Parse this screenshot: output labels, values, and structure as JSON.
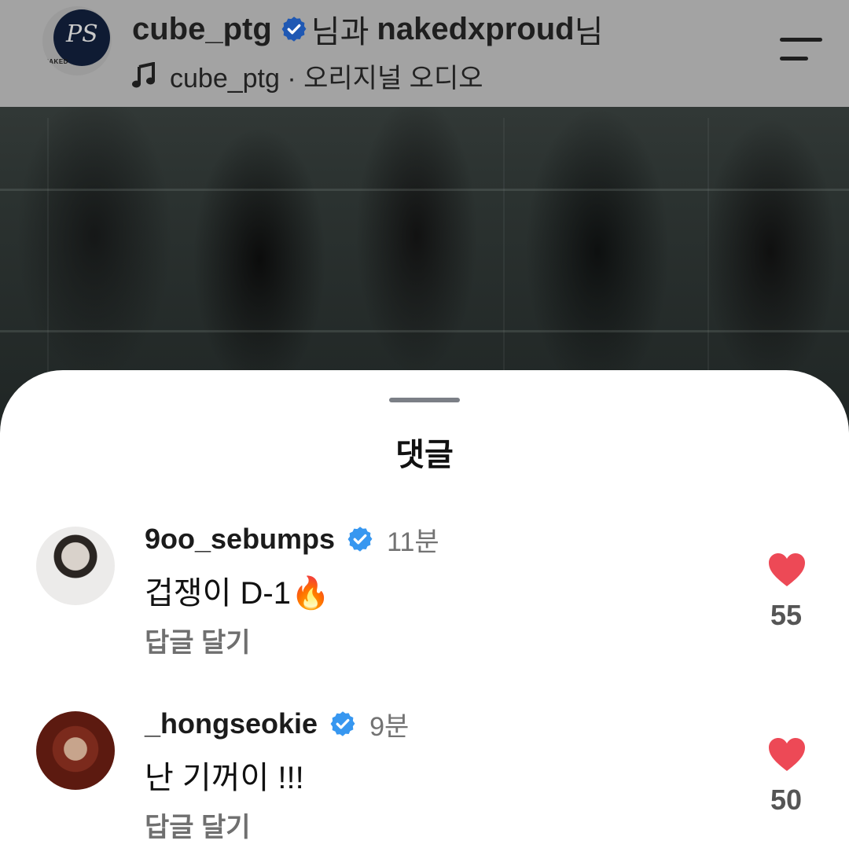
{
  "header": {
    "avatar_monogram": "PS",
    "avatar_brand": "NAKED",
    "username": "cube_ptg",
    "with_suffix": "님과",
    "collaborator": "nakedxproud",
    "collaborator_suffix": "님",
    "audio": "cube_ptg · 오리지널 오디오"
  },
  "sheet": {
    "title": "댓글"
  },
  "comments": [
    {
      "username": "9oo_sebumps",
      "time": "11분",
      "text": "겁쟁이 D-1🔥",
      "reply": "답글 달기",
      "likes": "55"
    },
    {
      "username": "_hongseokie",
      "time": "9분",
      "text": "난 기꺼이 !!!",
      "reply": "답글 달기",
      "likes": "50"
    }
  ],
  "colors": {
    "verified": "#3797f0",
    "heart": "#ed4956",
    "header_dim": "#a3a3a3"
  }
}
